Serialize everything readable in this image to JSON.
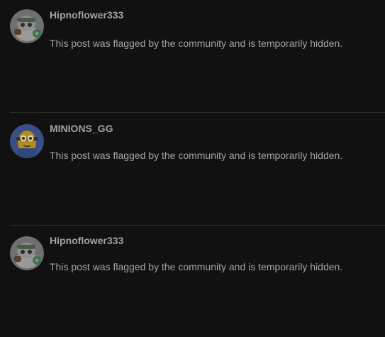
{
  "posts": [
    {
      "username": "Hipnoflower333",
      "avatar": "hipnoflower-avatar",
      "message": "This post was flagged by the community and is temporarily hidden."
    },
    {
      "username": "MINIONS_GG",
      "avatar": "minion-avatar",
      "message": "This post was flagged by the community and is temporarily hidden."
    },
    {
      "username": "Hipnoflower333",
      "avatar": "hipnoflower-avatar",
      "message": "This post was flagged by the community and is temporarily hidden."
    }
  ],
  "colors": {
    "background": "#111111",
    "text": "#a4a4a4",
    "divider": "#2e2e2e"
  }
}
